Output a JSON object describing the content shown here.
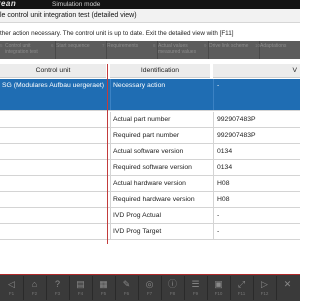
{
  "topbar": {
    "logo": "yean",
    "mode": "Simulation mode"
  },
  "title": "le control unit integration test (detailed view)",
  "hint": "ther action necessary. The control unit is up to date. Exit the detailed view with [F11]",
  "tabs": [
    {
      "idx": "5",
      "label": "Control unit integration test"
    },
    {
      "idx": "6",
      "label": "Start sequence"
    },
    {
      "idx": "7",
      "label": "Requirements"
    },
    {
      "idx": "8",
      "label": "Actual values measured values"
    },
    {
      "idx": "9",
      "label": "Drive link scheme"
    },
    {
      "idx": "10",
      "label": "Adaptations"
    }
  ],
  "table": {
    "headers": {
      "control_unit": "Control unit",
      "identification": "Identification",
      "value": "V"
    },
    "selected_row": {
      "control_unit": "SG (Modulares Aufbau uergeraet)",
      "identification": "Necessary action",
      "value": "-"
    },
    "rows": [
      {
        "identification": "Actual part number",
        "value": "992907483P"
      },
      {
        "identification": "Required part number",
        "value": "992907483P"
      },
      {
        "identification": "Actual software version",
        "value": "0134"
      },
      {
        "identification": "Required software version",
        "value": "0134"
      },
      {
        "identification": "Actual hardware version",
        "value": "H08"
      },
      {
        "identification": "Required hardware version",
        "value": "H08"
      },
      {
        "identification": "IVD Prog Actual",
        "value": "-"
      },
      {
        "identification": "IVD Prog Target",
        "value": "-"
      }
    ]
  },
  "bottom_buttons": [
    {
      "icon": "back-icon",
      "glyph": "◁",
      "key": "F1"
    },
    {
      "icon": "home-icon",
      "glyph": "⌂",
      "key": "F2"
    },
    {
      "icon": "help-icon",
      "glyph": "?",
      "key": "F3"
    },
    {
      "icon": "document-icon",
      "glyph": "▤",
      "key": "F4"
    },
    {
      "icon": "print-icon",
      "glyph": "▦",
      "key": "F5"
    },
    {
      "icon": "tools-icon",
      "glyph": "✎",
      "key": "F6"
    },
    {
      "icon": "measure-icon",
      "glyph": "◎",
      "key": "F7"
    },
    {
      "icon": "info-icon",
      "glyph": "ⓘ",
      "key": "F8"
    },
    {
      "icon": "list-icon",
      "glyph": "☰",
      "key": "F9"
    },
    {
      "icon": "detail-icon",
      "glyph": "▣",
      "key": "F10"
    },
    {
      "icon": "exit-detail-icon",
      "glyph": "⤢",
      "key": "F11"
    },
    {
      "icon": "forward-icon",
      "glyph": "▷",
      "key": "F12"
    },
    {
      "icon": "close-icon",
      "glyph": "✕",
      "key": ""
    }
  ]
}
